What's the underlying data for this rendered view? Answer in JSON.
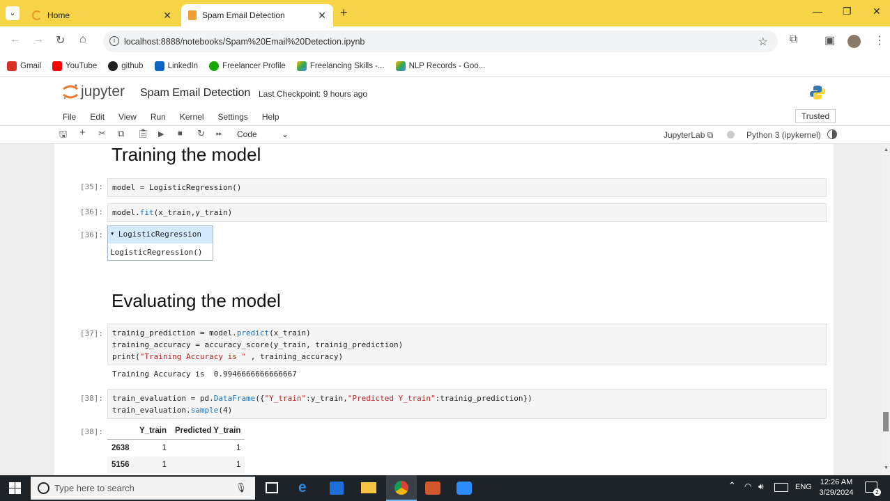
{
  "browser": {
    "tabs": [
      {
        "title": "Home",
        "active": false
      },
      {
        "title": "Spam Email Detection",
        "active": true
      }
    ],
    "url": "localhost:8888/notebooks/Spam%20Email%20Detection.ipynb",
    "bookmarks": [
      "Gmail",
      "YouTube",
      "github",
      "LinkedIn",
      "Freelancer Profile",
      "Freelancing Skills -...",
      "NLP Records - Goo..."
    ]
  },
  "jupyter": {
    "logo_text": "jupyter",
    "notebook_title": "Spam Email Detection",
    "checkpoint": "Last Checkpoint: 9 hours ago",
    "trusted": "Trusted",
    "menu": [
      "File",
      "Edit",
      "View",
      "Run",
      "Kernel",
      "Settings",
      "Help"
    ],
    "cell_type": "Code",
    "jupyterlab_link": "JupyterLab",
    "kernel": "Python 3 (ipykernel)"
  },
  "cells": {
    "h_training": "Training the model",
    "c35_prompt": "[35]:",
    "c35_code": "model = LogisticRegression()",
    "c36_prompt": "[36]:",
    "c36_code_a": "model.",
    "c36_code_b": "fit",
    "c36_code_c": "(x_train,y_train)",
    "o36_prompt": "[36]:",
    "o36_header": "LogisticRegression",
    "o36_body": "LogisticRegression()",
    "h_eval": "Evaluating the model",
    "c37_prompt": "[37]:",
    "c37_l1a": "trainig_prediction = model.",
    "c37_l1b": "predict",
    "c37_l1c": "(x_train)",
    "c37_l2": "training_accuracy = accuracy_score(y_train, trainig_prediction)",
    "c37_l3a": "print(",
    "c37_l3b": "\"Training Accuracy is \"",
    "c37_l3c": " , training_accuracy)",
    "o37": "Training Accuracy is  0.9946666666666667",
    "c38_prompt": "[38]:",
    "c38_l1a": "train_evaluation = pd.",
    "c38_l1b": "DataFrame",
    "c38_l1c": "({",
    "c38_l1d": "\"Y_train\"",
    "c38_l1e": ":y_train,",
    "c38_l1f": "\"Predicted Y_train\"",
    "c38_l1g": ":trainig_prediction})",
    "c38_l2a": "train_evaluation.",
    "c38_l2b": "sample",
    "c38_l2c": "(4)",
    "o38_prompt": "[38]:",
    "df_columns": [
      "",
      "Y_train",
      "Predicted Y_train"
    ],
    "df_rows": [
      [
        "2638",
        "1",
        "1"
      ],
      [
        "5156",
        "1",
        "1"
      ]
    ]
  },
  "taskbar": {
    "search_placeholder": "Type here to search",
    "lang": "ENG",
    "time": "12:26 AM",
    "date": "3/29/2024",
    "notifications": "2"
  }
}
